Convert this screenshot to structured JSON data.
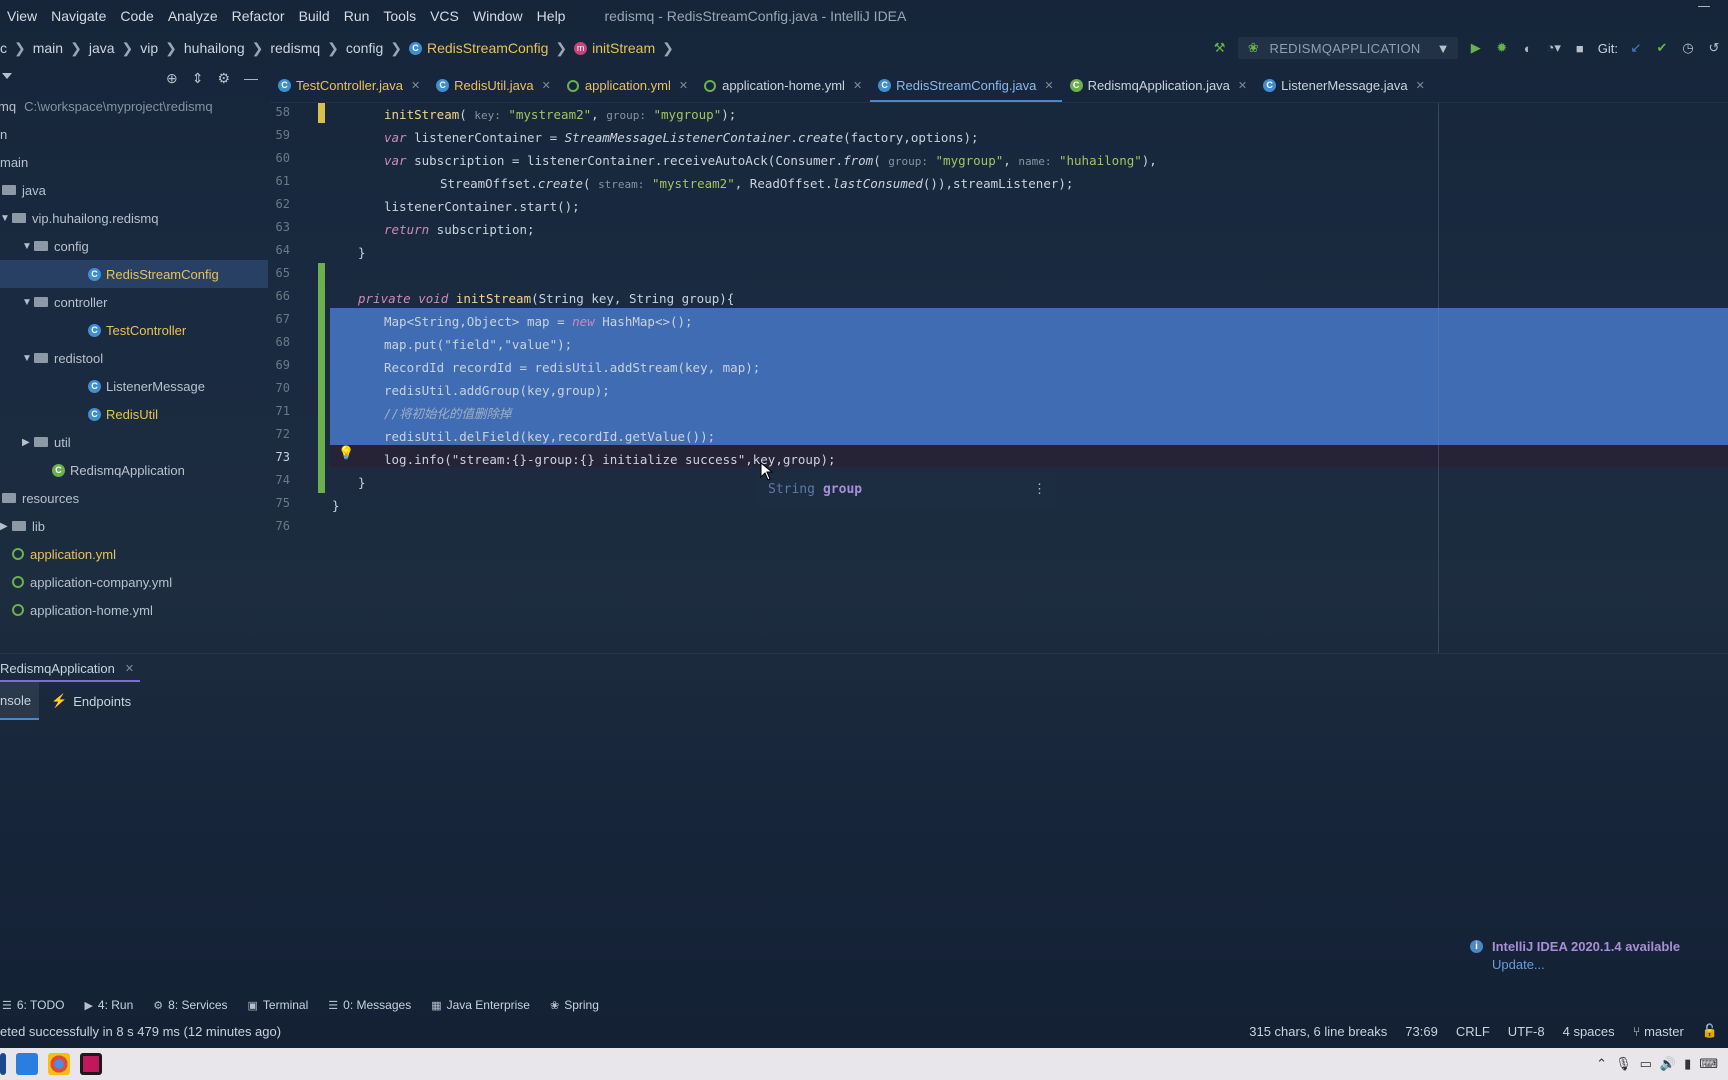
{
  "menubar": {
    "items": [
      "View",
      "Navigate",
      "Code",
      "Analyze",
      "Refactor",
      "Build",
      "Run",
      "Tools",
      "VCS",
      "Window",
      "Help"
    ],
    "window_title": "redismq - RedisStreamConfig.java - IntelliJ IDEA"
  },
  "breadcrumbs": [
    "c",
    "main",
    "java",
    "vip",
    "huhailong",
    "redismq",
    "config",
    "RedisStreamConfig",
    "initStream"
  ],
  "run_config": {
    "name": "REDISMQAPPLICATION",
    "git_label": "Git:"
  },
  "project": {
    "root_name": "mq",
    "root_path": "C:\\workspace\\myproject\\redismq",
    "tree": [
      {
        "label": "n",
        "indent": 0,
        "kind": "text"
      },
      {
        "label": "main",
        "indent": 0,
        "kind": "text"
      },
      {
        "label": "java",
        "indent": 0,
        "kind": "folder"
      },
      {
        "label": "vip.huhailong.redismq",
        "indent": 0,
        "kind": "folder-open"
      },
      {
        "label": "config",
        "indent": 1,
        "kind": "folder-open"
      },
      {
        "label": "RedisStreamConfig",
        "indent": 2,
        "kind": "class-yellow",
        "selected": true
      },
      {
        "label": "controller",
        "indent": 1,
        "kind": "folder-open"
      },
      {
        "label": "TestController",
        "indent": 2,
        "kind": "class-yellow"
      },
      {
        "label": "redistool",
        "indent": 1,
        "kind": "folder-open"
      },
      {
        "label": "ListenerMessage",
        "indent": 2,
        "kind": "class"
      },
      {
        "label": "RedisUtil",
        "indent": 2,
        "kind": "class-yellow"
      },
      {
        "label": "util",
        "indent": 1,
        "kind": "folder-closed"
      },
      {
        "label": "RedismqApplication",
        "indent": 1,
        "kind": "app"
      },
      {
        "label": "resources",
        "indent": 0,
        "kind": "folder"
      },
      {
        "label": "lib",
        "indent": 0,
        "kind": "folder-closed"
      },
      {
        "label": "application.yml",
        "indent": 0,
        "kind": "yml-yellow"
      },
      {
        "label": "application-company.yml",
        "indent": 0,
        "kind": "yml"
      },
      {
        "label": "application-home.yml",
        "indent": 0,
        "kind": "yml"
      }
    ]
  },
  "tabs": [
    {
      "label": "TestController.java",
      "icon": "class",
      "yellow": true
    },
    {
      "label": "RedisUtil.java",
      "icon": "class",
      "yellow": true
    },
    {
      "label": "application.yml",
      "icon": "yml",
      "yellow": true
    },
    {
      "label": "application-home.yml",
      "icon": "yml",
      "yellow": false
    },
    {
      "label": "RedisStreamConfig.java",
      "icon": "class",
      "active": true
    },
    {
      "label": "RedismqApplication.java",
      "icon": "app",
      "yellow": false
    },
    {
      "label": "ListenerMessage.java",
      "icon": "class",
      "yellow": false
    }
  ],
  "editor": {
    "line_numbers": [
      "58",
      "59",
      "60",
      "61",
      "62",
      "63",
      "64",
      "65",
      "66",
      "67",
      "68",
      "69",
      "70",
      "71",
      "72",
      "73",
      "74",
      "75",
      "76"
    ],
    "tooltip": {
      "type": "String",
      "name": "group"
    }
  },
  "run_panel": {
    "title": "RedismqApplication",
    "subtabs": [
      "nsole",
      "Endpoints"
    ]
  },
  "notification": {
    "title": "IntelliJ IDEA 2020.1.4 available",
    "link": "Update..."
  },
  "tool_windows": [
    {
      "label": "6: TODO",
      "icon": "list-icon"
    },
    {
      "label": "4: Run",
      "icon": "play-icon"
    },
    {
      "label": "8: Services",
      "icon": "services-icon"
    },
    {
      "label": "Terminal",
      "icon": "terminal-icon"
    },
    {
      "label": "0: Messages",
      "icon": "messages-icon"
    },
    {
      "label": "Java Enterprise",
      "icon": "java-enterprise-icon"
    },
    {
      "label": "Spring",
      "icon": "spring-icon"
    }
  ],
  "status": {
    "message": "eted successfully in 8 s 479 ms (12 minutes ago)",
    "selection": "315 chars, 6 line breaks",
    "position": "73:69",
    "line_sep": "CRLF",
    "encoding": "UTF-8",
    "indent": "4 spaces",
    "branch": "master"
  },
  "colors": {
    "accent": "#4a88c7",
    "selection": "#4678c8",
    "string": "#a5c261",
    "keyword": "#cc8bb8"
  }
}
